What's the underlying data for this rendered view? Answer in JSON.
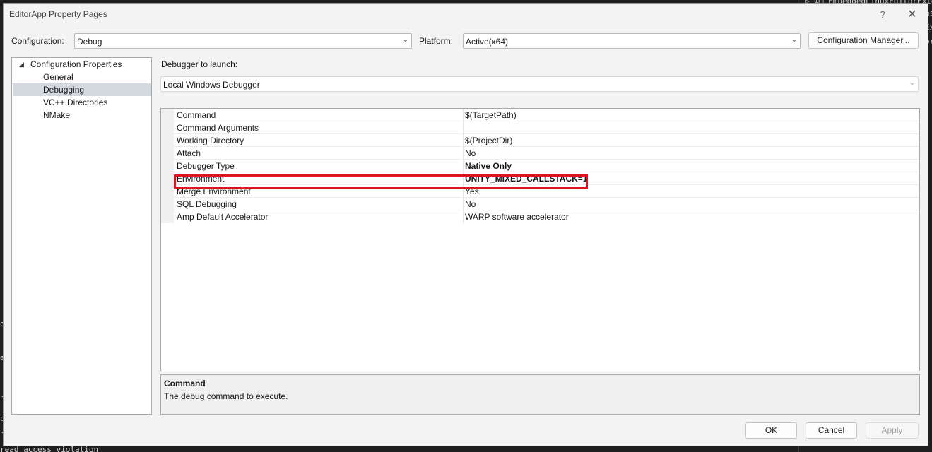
{
  "window": {
    "title": "EditorApp Property Pages",
    "help_glyph": "?",
    "close_glyph": "✕"
  },
  "toolbar": {
    "configuration_label": "Configuration:",
    "configuration_value": "Debug",
    "platform_label": "Platform:",
    "platform_value": "Active(x64)",
    "config_manager_label": "Configuration Manager..."
  },
  "tree": {
    "root_label": "Configuration Properties",
    "items": [
      {
        "label": "General"
      },
      {
        "label": "Debugging",
        "selected": true
      },
      {
        "label": "VC++ Directories"
      },
      {
        "label": "NMake"
      }
    ]
  },
  "debugger": {
    "launch_label": "Debugger to launch:",
    "launch_value": "Local Windows Debugger"
  },
  "properties": [
    {
      "name": "Command",
      "value": "$(TargetPath)"
    },
    {
      "name": "Command Arguments",
      "value": ""
    },
    {
      "name": "Working Directory",
      "value": "$(ProjectDir)"
    },
    {
      "name": "Attach",
      "value": "No"
    },
    {
      "name": "Debugger Type",
      "value": "Native Only",
      "bold": true
    },
    {
      "name": "Environment",
      "value": "UNITY_MIXED_CALLSTACK=1",
      "bold": true,
      "highlighted": true
    },
    {
      "name": "Merge Environment",
      "value": "Yes"
    },
    {
      "name": "SQL Debugging",
      "value": "No"
    },
    {
      "name": "Amp Default Accelerator",
      "value": "WARP software accelerator"
    }
  ],
  "description": {
    "title": "Command",
    "text": "The debug command to execute."
  },
  "buttons": {
    "ok": "OK",
    "cancel": "Cancel",
    "apply": "Apply"
  },
  "background": {
    "right_fragments": [
      "▷ ⊕▢ EmbeddedLinuxEditorExte",
      "ns",
      "Ex",
      "or"
    ],
    "left_fragments": [
      "o",
      "e",
      "..",
      "p",
      ".."
    ],
    "bottom_text": "read access violation"
  },
  "colors": {
    "highlight_box": "#e0141e",
    "selected_item": "#d4d8df",
    "dialog_bg": "#f3f3f3"
  }
}
